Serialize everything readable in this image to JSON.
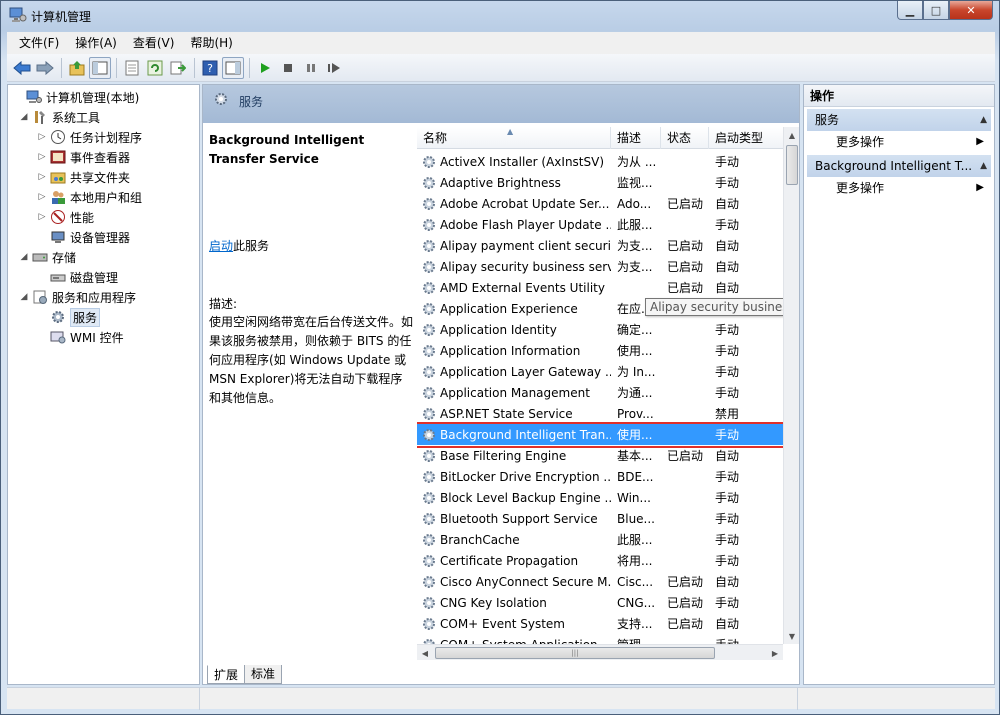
{
  "window": {
    "title": "计算机管理"
  },
  "menu": [
    "文件(F)",
    "操作(A)",
    "查看(V)",
    "帮助(H)"
  ],
  "tree": [
    {
      "label": "计算机管理(本地)",
      "expander": "",
      "icon": "computer-management-icon"
    },
    {
      "label": "系统工具",
      "expander": "◢",
      "icon": "tools-icon"
    },
    {
      "label": "任务计划程序",
      "expander": "▷",
      "icon": "task-scheduler-icon"
    },
    {
      "label": "事件查看器",
      "expander": "▷",
      "icon": "event-viewer-icon"
    },
    {
      "label": "共享文件夹",
      "expander": "▷",
      "icon": "shared-folder-icon"
    },
    {
      "label": "本地用户和组",
      "expander": "▷",
      "icon": "users-icon"
    },
    {
      "label": "性能",
      "expander": "▷",
      "icon": "performance-icon"
    },
    {
      "label": "设备管理器",
      "expander": "",
      "icon": "device-manager-icon"
    },
    {
      "label": "存储",
      "expander": "◢",
      "icon": "storage-icon"
    },
    {
      "label": "磁盘管理",
      "expander": "",
      "icon": "disk-management-icon"
    },
    {
      "label": "服务和应用程序",
      "expander": "◢",
      "icon": "services-apps-icon"
    },
    {
      "label": "服务",
      "expander": "",
      "icon": "services-gear-icon"
    },
    {
      "label": "WMI 控件",
      "expander": "",
      "icon": "wmi-icon"
    }
  ],
  "center": {
    "header": "服务",
    "selected_name": "Background Intelligent Transfer Service",
    "start_link": "启动",
    "start_suffix": "此服务",
    "desc_label": "描述:",
    "description": "使用空闲网络带宽在后台传送文件。如果该服务被禁用，则依赖于 BITS 的任何应用程序(如 Windows Update 或 MSN Explorer)将无法自动下载程序和其他信息。",
    "columns": [
      "名称",
      "描述",
      "状态",
      "启动类型"
    ],
    "tooltip": "Alipay security business service",
    "tabs": [
      "扩展",
      "标准"
    ]
  },
  "services": [
    {
      "name": "ActiveX Installer (AxInstSV)",
      "desc": "为从 ...",
      "status": "",
      "startup": "手动"
    },
    {
      "name": "Adaptive Brightness",
      "desc": "监视...",
      "status": "",
      "startup": "手动"
    },
    {
      "name": "Adobe Acrobat Update Ser...",
      "desc": "Ado...",
      "status": "已启动",
      "startup": "自动"
    },
    {
      "name": "Adobe Flash Player Update ...",
      "desc": "此服...",
      "status": "",
      "startup": "手动"
    },
    {
      "name": "Alipay payment client securi...",
      "desc": "为支...",
      "status": "已启动",
      "startup": "自动"
    },
    {
      "name": "Alipay security business service",
      "desc": "为支...",
      "status": "已启动",
      "startup": "自动"
    },
    {
      "name": "AMD External Events Utility",
      "desc": "",
      "status": "已启动",
      "startup": "自动"
    },
    {
      "name": "Application Experience",
      "desc": "在应...",
      "status": "已启动",
      "startup": "手动"
    },
    {
      "name": "Application Identity",
      "desc": "确定...",
      "status": "",
      "startup": "手动"
    },
    {
      "name": "Application Information",
      "desc": "使用...",
      "status": "",
      "startup": "手动"
    },
    {
      "name": "Application Layer Gateway ...",
      "desc": "为 In...",
      "status": "",
      "startup": "手动"
    },
    {
      "name": "Application Management",
      "desc": "为通...",
      "status": "",
      "startup": "手动"
    },
    {
      "name": "ASP.NET State Service",
      "desc": "Prov...",
      "status": "",
      "startup": "禁用"
    },
    {
      "name": "Background Intelligent Tran...",
      "desc": "使用...",
      "status": "",
      "startup": "手动"
    },
    {
      "name": "Base Filtering Engine",
      "desc": "基本...",
      "status": "已启动",
      "startup": "自动"
    },
    {
      "name": "BitLocker Drive Encryption ...",
      "desc": "BDE...",
      "status": "",
      "startup": "手动"
    },
    {
      "name": "Block Level Backup Engine ...",
      "desc": "Win...",
      "status": "",
      "startup": "手动"
    },
    {
      "name": "Bluetooth Support Service",
      "desc": "Blue...",
      "status": "",
      "startup": "手动"
    },
    {
      "name": "BranchCache",
      "desc": "此服...",
      "status": "",
      "startup": "手动"
    },
    {
      "name": "Certificate Propagation",
      "desc": "将用...",
      "status": "",
      "startup": "手动"
    },
    {
      "name": "Cisco AnyConnect Secure M...",
      "desc": "Cisc...",
      "status": "已启动",
      "startup": "自动"
    },
    {
      "name": "CNG Key Isolation",
      "desc": "CNG...",
      "status": "已启动",
      "startup": "手动"
    },
    {
      "name": "COM+ Event System",
      "desc": "支持...",
      "status": "已启动",
      "startup": "自动"
    },
    {
      "name": "COM+ System Application",
      "desc": "管理...",
      "status": "",
      "startup": "手动"
    }
  ],
  "selected_index": 13,
  "actions": {
    "title": "操作",
    "sections": [
      {
        "label": "服务",
        "item": "更多操作"
      },
      {
        "label": "Background Intelligent T...",
        "item": "更多操作"
      }
    ]
  }
}
